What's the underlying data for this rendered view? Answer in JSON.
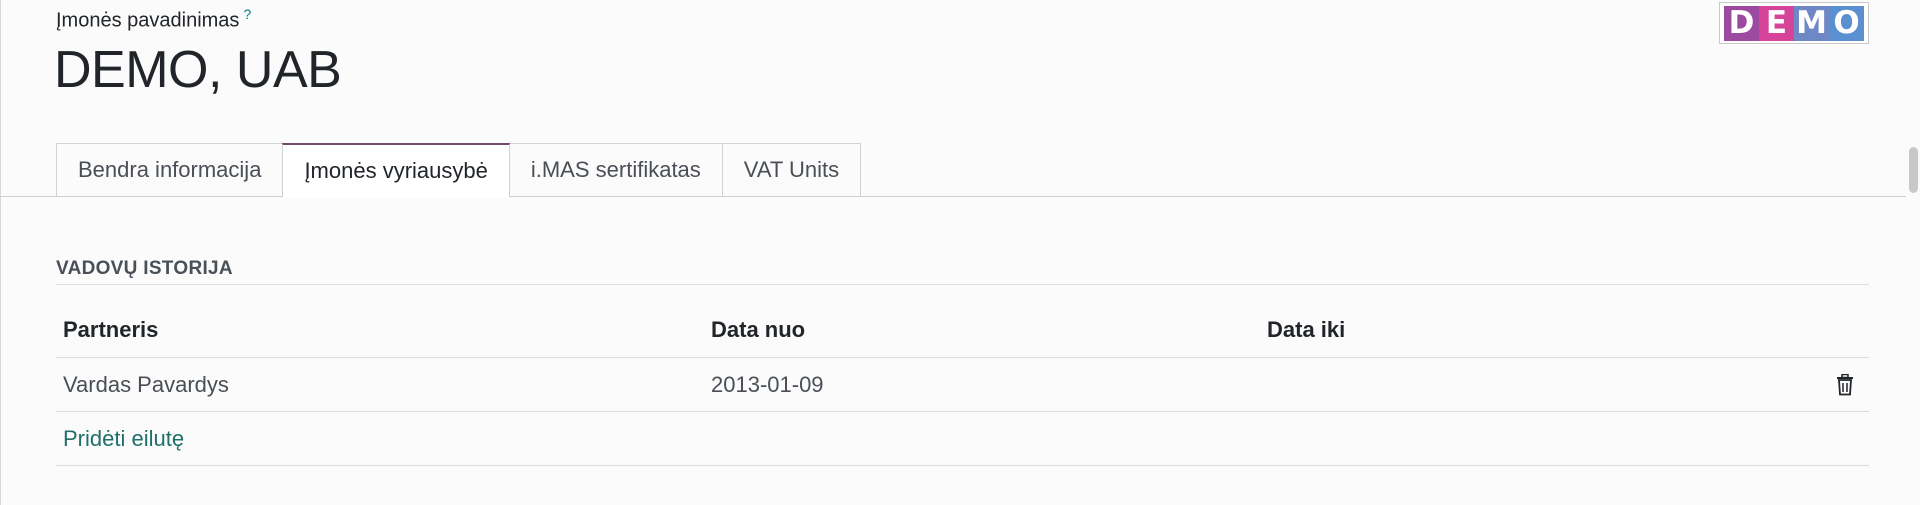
{
  "header": {
    "field_label": "Įmonės pavadinimas",
    "help_mark": "?",
    "company_name": "DEMO, UAB"
  },
  "logo": {
    "letters": [
      "D",
      "E",
      "M",
      "O"
    ],
    "colors": [
      "#9c4a9f",
      "#d6449a",
      "#6e87c5",
      "#5a8fd0"
    ]
  },
  "tabs": [
    {
      "label": "Bendra informacija",
      "active": false
    },
    {
      "label": "Įmonės vyriausybė",
      "active": true
    },
    {
      "label": "i.MAS sertifikatas",
      "active": false
    },
    {
      "label": "VAT Units",
      "active": false
    }
  ],
  "section": {
    "title": "VADOVŲ ISTORIJA"
  },
  "table": {
    "columns": [
      "Partneris",
      "Data nuo",
      "Data iki"
    ],
    "rows": [
      {
        "partner": "Vardas Pavardys",
        "date_from": "2013-01-09",
        "date_to": ""
      }
    ],
    "add_line_label": "Pridėti eilutę"
  },
  "colors": {
    "accent": "#714b67",
    "link": "#1f6f6a"
  }
}
